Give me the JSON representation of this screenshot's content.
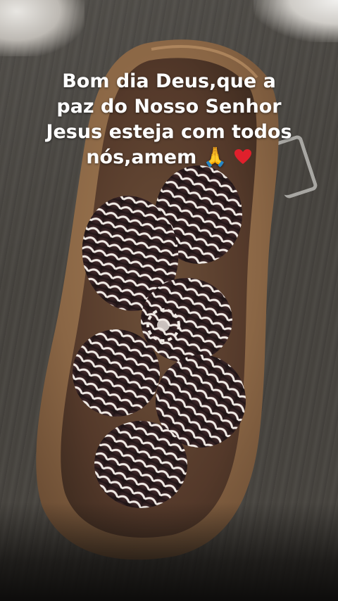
{
  "story": {
    "caption": "Bom dia Deus,que a paz do Nosso Senhor Jesus esteja com todos nós,amem",
    "emoji_pray": "🙏",
    "emoji_heart": "❤️"
  },
  "colors": {
    "background": "#46433e",
    "bowl_wood": "#8c6a47",
    "bowl_inner": "#5e4430",
    "pinecone": "#3a2626",
    "snow_tips": "#efe9e4",
    "caption_text": "#ffffff"
  },
  "icons": [
    "pray-icon",
    "heart-icon",
    "pinecone-icon"
  ]
}
